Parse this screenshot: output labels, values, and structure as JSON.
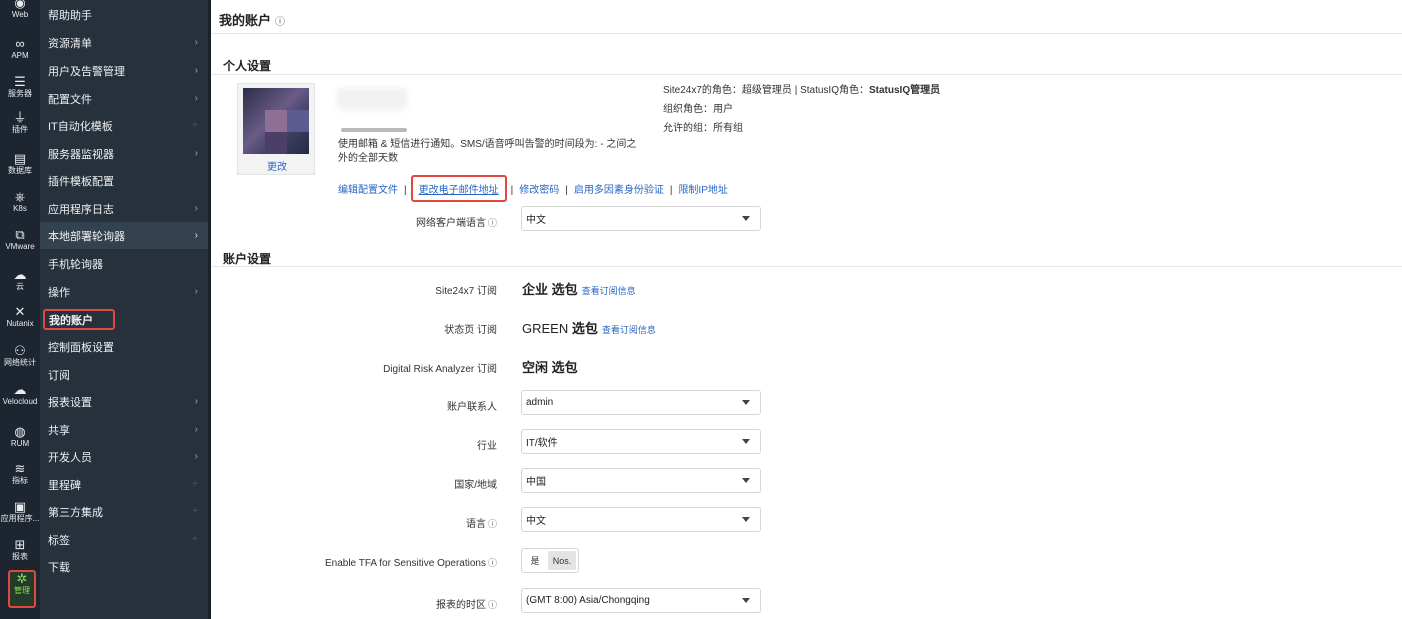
{
  "rail": [
    {
      "glyph": "◉",
      "label": "Web",
      "icon": "globe-icon"
    },
    {
      "glyph": "∞",
      "label": "APM",
      "icon": "binoculars-icon"
    },
    {
      "glyph": "☰",
      "label": "服务器",
      "icon": "server-icon"
    },
    {
      "glyph": "⏚",
      "label": "插件",
      "icon": "plug-icon"
    },
    {
      "glyph": "▤",
      "label": "数据库",
      "icon": "database-icon"
    },
    {
      "glyph": "⎈",
      "label": "K8s",
      "icon": "kubernetes-icon"
    },
    {
      "glyph": "⧉",
      "label": "VMware",
      "icon": "vmware-icon"
    },
    {
      "glyph": "☁",
      "label": "云",
      "icon": "cloud-icon"
    },
    {
      "glyph": "✕",
      "label": "Nutanix",
      "icon": "nutanix-icon"
    },
    {
      "glyph": "⚇",
      "label": "网络统计",
      "icon": "network-icon"
    },
    {
      "glyph": "☁",
      "label": "Velocloud",
      "icon": "velocloud-icon"
    },
    {
      "glyph": "◍",
      "label": "RUM",
      "icon": "rum-globe-icon"
    },
    {
      "glyph": "≋",
      "label": "指标",
      "icon": "metrics-icon"
    },
    {
      "glyph": "▣",
      "label": "应用程序...",
      "icon": "app-icon"
    },
    {
      "glyph": "⊞",
      "label": "报表",
      "icon": "report-icon"
    },
    {
      "glyph": "✲",
      "label": "管理",
      "icon": "gear-icon"
    }
  ],
  "nav": [
    {
      "label": "帮助助手",
      "arrow": "none"
    },
    {
      "label": "资源清单",
      "arrow": "›"
    },
    {
      "label": "用户及告警管理",
      "arrow": "›"
    },
    {
      "label": "配置文件",
      "arrow": "›"
    },
    {
      "label": "IT自动化模板",
      "arrow": "+"
    },
    {
      "label": "服务器监视器",
      "arrow": "›"
    },
    {
      "label": "插件模板配置",
      "arrow": "none"
    },
    {
      "label": "应用程序日志",
      "arrow": "›"
    },
    {
      "label": "本地部署轮询器",
      "arrow": "›"
    },
    {
      "label": "手机轮询器",
      "arrow": "none"
    },
    {
      "label": "操作",
      "arrow": "›"
    },
    {
      "label": "我的账户",
      "arrow": "none"
    },
    {
      "label": "控制面板设置",
      "arrow": "none"
    },
    {
      "label": "订阅",
      "arrow": "none"
    },
    {
      "label": "报表设置",
      "arrow": "›"
    },
    {
      "label": "共享",
      "arrow": "›"
    },
    {
      "label": "开发人员",
      "arrow": "›"
    },
    {
      "label": "里程碑",
      "arrow": "+"
    },
    {
      "label": "第三方集成",
      "arrow": "+"
    },
    {
      "label": "标签",
      "arrow": "+"
    },
    {
      "label": "下载",
      "arrow": "none"
    }
  ],
  "page": {
    "title": "我的账户",
    "info_glyph": "ⓘ"
  },
  "personal": {
    "heading": "个人设置",
    "change_photo": "更改",
    "notice": "使用邮箱 & 短信进行通知。SMS/语音呼叫告警的时间段为: - 之间之外的全部天数",
    "role_line_prefix": "Site24x7的角色：超级管理员 | StatusIQ角色：",
    "role_line_bold": "StatusIQ管理员",
    "org_role": "组织角色：用户",
    "allowed_groups": "允许的组：所有组",
    "links": {
      "edit_profile": "编辑配置文件",
      "change_email": "更改电子邮件地址",
      "change_password": "修改密码",
      "enable_mfa": "启用多因素身份验证",
      "restrict_ip": "限制IP地址",
      "sep": "|"
    },
    "client_lang_label": "网络客户端语言",
    "client_lang_value": "中文"
  },
  "account": {
    "heading": "账户设置",
    "site24x7_label": "Site24x7 订阅",
    "site24x7_plan": "企业",
    "site24x7_suffix": "选包",
    "site24x7_link": "查看订阅信息",
    "status_label": "状态页 订阅",
    "status_plan": "GREEN",
    "status_suffix": "选包",
    "status_link": "查看订阅信息",
    "dra_label": "Digital Risk Analyzer 订阅",
    "dra_plan": "空闲",
    "dra_suffix": "选包",
    "contact_label": "账户联系人",
    "contact_value": "admin",
    "industry_label": "行业",
    "industry_value": "IT/软件",
    "country_label": "国家/地域",
    "country_value": "中国",
    "lang_label": "语言",
    "lang_value": "中文",
    "tfa_label": "Enable TFA for Sensitive Operations",
    "tfa_yes": "是",
    "tfa_no": "Nos.",
    "tz_label": "报表的时区",
    "tz_value": "(GMT 8:00) Asia/Chongqing"
  }
}
